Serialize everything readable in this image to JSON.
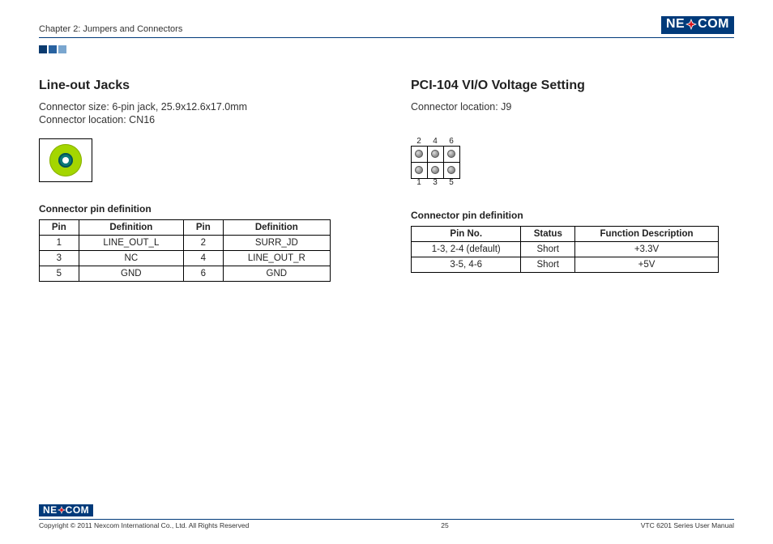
{
  "header": {
    "chapter": "Chapter 2: Jumpers and Connectors",
    "logo_text_left": "NE",
    "logo_text_right": "COM"
  },
  "left": {
    "title": "Line-out Jacks",
    "size_line": "Connector size: 6-pin jack, 25.9x12.6x17.0mm",
    "location_line": "Connector location: CN16",
    "table_caption": "Connector pin definition",
    "table_headers": {
      "pin": "Pin",
      "def": "Definition"
    },
    "rows": [
      {
        "p1": "1",
        "d1": "LINE_OUT_L",
        "p2": "2",
        "d2": "SURR_JD"
      },
      {
        "p1": "3",
        "d1": "NC",
        "p2": "4",
        "d2": "LINE_OUT_R"
      },
      {
        "p1": "5",
        "d1": "GND",
        "p2": "6",
        "d2": "GND"
      }
    ]
  },
  "right": {
    "title": "PCI-104 VI/O Voltage Setting",
    "location_line": "Connector location: J9",
    "pin_labels_top": {
      "a": "2",
      "b": "4",
      "c": "6"
    },
    "pin_labels_bottom": {
      "a": "1",
      "b": "3",
      "c": "5"
    },
    "table_caption": "Connector pin definition",
    "table_headers": {
      "pin": "Pin No.",
      "status": "Status",
      "func": "Function Description"
    },
    "rows": [
      {
        "pin": "1-3, 2-4 (default)",
        "status": "Short",
        "func": "+3.3V"
      },
      {
        "pin": "3-5, 4-6",
        "status": "Short",
        "func": "+5V"
      }
    ]
  },
  "footer": {
    "copyright": "Copyright © 2011 Nexcom International Co., Ltd. All Rights Reserved",
    "page": "25",
    "manual": "VTC 6201 Series User Manual"
  }
}
